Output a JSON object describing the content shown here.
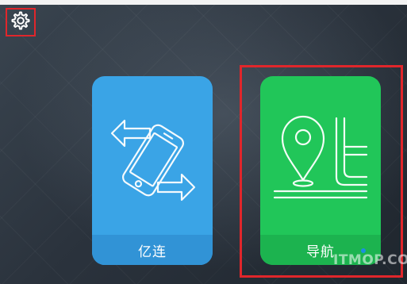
{
  "header": {
    "settings_icon": "gear-icon"
  },
  "cards": [
    {
      "label": "亿连",
      "icon": "phone-rotate-icon",
      "color": "#3aa4e6"
    },
    {
      "label": "导航",
      "icon": "map-pin-route-icon",
      "color": "#21c659"
    }
  ],
  "highlight_color": "#e0262b",
  "watermark": "ITMOP.COM"
}
